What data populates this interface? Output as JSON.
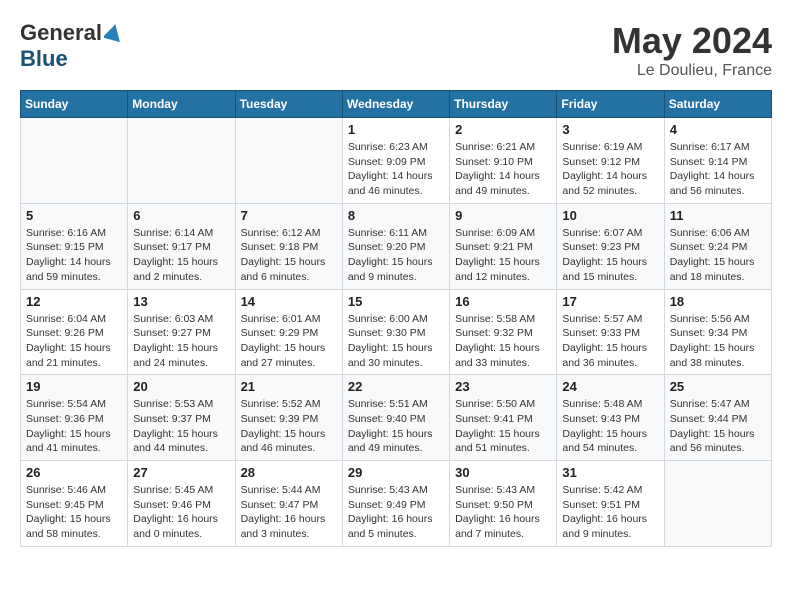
{
  "logo": {
    "general": "General",
    "blue": "Blue"
  },
  "title": "May 2024",
  "location": "Le Doulieu, France",
  "days_header": [
    "Sunday",
    "Monday",
    "Tuesday",
    "Wednesday",
    "Thursday",
    "Friday",
    "Saturday"
  ],
  "weeks": [
    [
      {
        "day": "",
        "info": ""
      },
      {
        "day": "",
        "info": ""
      },
      {
        "day": "",
        "info": ""
      },
      {
        "day": "1",
        "info": "Sunrise: 6:23 AM\nSunset: 9:09 PM\nDaylight: 14 hours\nand 46 minutes."
      },
      {
        "day": "2",
        "info": "Sunrise: 6:21 AM\nSunset: 9:10 PM\nDaylight: 14 hours\nand 49 minutes."
      },
      {
        "day": "3",
        "info": "Sunrise: 6:19 AM\nSunset: 9:12 PM\nDaylight: 14 hours\nand 52 minutes."
      },
      {
        "day": "4",
        "info": "Sunrise: 6:17 AM\nSunset: 9:14 PM\nDaylight: 14 hours\nand 56 minutes."
      }
    ],
    [
      {
        "day": "5",
        "info": "Sunrise: 6:16 AM\nSunset: 9:15 PM\nDaylight: 14 hours\nand 59 minutes."
      },
      {
        "day": "6",
        "info": "Sunrise: 6:14 AM\nSunset: 9:17 PM\nDaylight: 15 hours\nand 2 minutes."
      },
      {
        "day": "7",
        "info": "Sunrise: 6:12 AM\nSunset: 9:18 PM\nDaylight: 15 hours\nand 6 minutes."
      },
      {
        "day": "8",
        "info": "Sunrise: 6:11 AM\nSunset: 9:20 PM\nDaylight: 15 hours\nand 9 minutes."
      },
      {
        "day": "9",
        "info": "Sunrise: 6:09 AM\nSunset: 9:21 PM\nDaylight: 15 hours\nand 12 minutes."
      },
      {
        "day": "10",
        "info": "Sunrise: 6:07 AM\nSunset: 9:23 PM\nDaylight: 15 hours\nand 15 minutes."
      },
      {
        "day": "11",
        "info": "Sunrise: 6:06 AM\nSunset: 9:24 PM\nDaylight: 15 hours\nand 18 minutes."
      }
    ],
    [
      {
        "day": "12",
        "info": "Sunrise: 6:04 AM\nSunset: 9:26 PM\nDaylight: 15 hours\nand 21 minutes."
      },
      {
        "day": "13",
        "info": "Sunrise: 6:03 AM\nSunset: 9:27 PM\nDaylight: 15 hours\nand 24 minutes."
      },
      {
        "day": "14",
        "info": "Sunrise: 6:01 AM\nSunset: 9:29 PM\nDaylight: 15 hours\nand 27 minutes."
      },
      {
        "day": "15",
        "info": "Sunrise: 6:00 AM\nSunset: 9:30 PM\nDaylight: 15 hours\nand 30 minutes."
      },
      {
        "day": "16",
        "info": "Sunrise: 5:58 AM\nSunset: 9:32 PM\nDaylight: 15 hours\nand 33 minutes."
      },
      {
        "day": "17",
        "info": "Sunrise: 5:57 AM\nSunset: 9:33 PM\nDaylight: 15 hours\nand 36 minutes."
      },
      {
        "day": "18",
        "info": "Sunrise: 5:56 AM\nSunset: 9:34 PM\nDaylight: 15 hours\nand 38 minutes."
      }
    ],
    [
      {
        "day": "19",
        "info": "Sunrise: 5:54 AM\nSunset: 9:36 PM\nDaylight: 15 hours\nand 41 minutes."
      },
      {
        "day": "20",
        "info": "Sunrise: 5:53 AM\nSunset: 9:37 PM\nDaylight: 15 hours\nand 44 minutes."
      },
      {
        "day": "21",
        "info": "Sunrise: 5:52 AM\nSunset: 9:39 PM\nDaylight: 15 hours\nand 46 minutes."
      },
      {
        "day": "22",
        "info": "Sunrise: 5:51 AM\nSunset: 9:40 PM\nDaylight: 15 hours\nand 49 minutes."
      },
      {
        "day": "23",
        "info": "Sunrise: 5:50 AM\nSunset: 9:41 PM\nDaylight: 15 hours\nand 51 minutes."
      },
      {
        "day": "24",
        "info": "Sunrise: 5:48 AM\nSunset: 9:43 PM\nDaylight: 15 hours\nand 54 minutes."
      },
      {
        "day": "25",
        "info": "Sunrise: 5:47 AM\nSunset: 9:44 PM\nDaylight: 15 hours\nand 56 minutes."
      }
    ],
    [
      {
        "day": "26",
        "info": "Sunrise: 5:46 AM\nSunset: 9:45 PM\nDaylight: 15 hours\nand 58 minutes."
      },
      {
        "day": "27",
        "info": "Sunrise: 5:45 AM\nSunset: 9:46 PM\nDaylight: 16 hours\nand 0 minutes."
      },
      {
        "day": "28",
        "info": "Sunrise: 5:44 AM\nSunset: 9:47 PM\nDaylight: 16 hours\nand 3 minutes."
      },
      {
        "day": "29",
        "info": "Sunrise: 5:43 AM\nSunset: 9:49 PM\nDaylight: 16 hours\nand 5 minutes."
      },
      {
        "day": "30",
        "info": "Sunrise: 5:43 AM\nSunset: 9:50 PM\nDaylight: 16 hours\nand 7 minutes."
      },
      {
        "day": "31",
        "info": "Sunrise: 5:42 AM\nSunset: 9:51 PM\nDaylight: 16 hours\nand 9 minutes."
      },
      {
        "day": "",
        "info": ""
      }
    ]
  ]
}
